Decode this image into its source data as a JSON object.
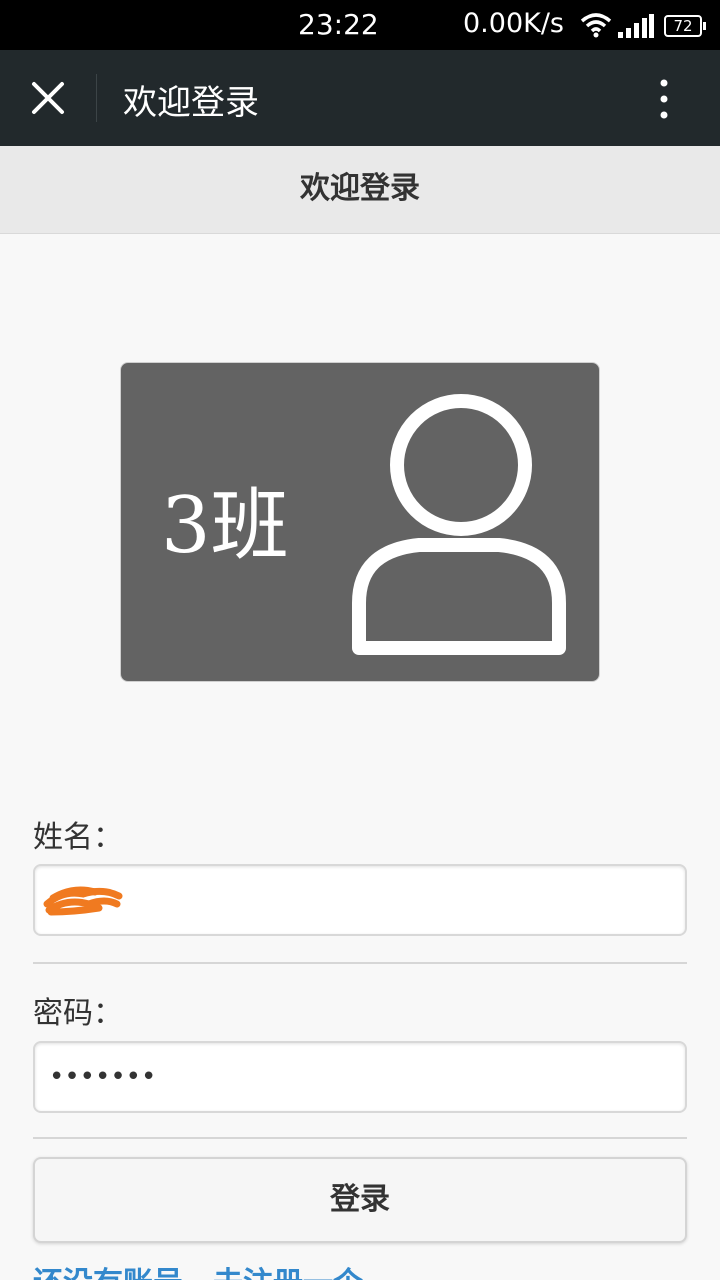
{
  "status_bar": {
    "time": "23:22",
    "net_speed": "0.00K/s",
    "battery": "72",
    "icons": [
      "wifi-icon",
      "signal-icon",
      "battery-icon"
    ]
  },
  "app_bar": {
    "title": "欢迎登录",
    "close_icon": "close-icon",
    "more_icon": "more-vertical-icon"
  },
  "page": {
    "header": "欢迎登录"
  },
  "banner": {
    "class_name": "3班",
    "icon": "person-icon"
  },
  "form": {
    "name_label": "姓名：",
    "name_value": "",
    "password_label": "密码：",
    "password_value": "•••••••",
    "login_button": "登录"
  },
  "register_link": "还没有账号，去注册一个",
  "colors": {
    "status_bar": "#000000",
    "app_bar": "#22292c",
    "page_header": "#e9e9e9",
    "banner": "#636363",
    "link": "#3388cc",
    "redaction": "#f07a20"
  }
}
